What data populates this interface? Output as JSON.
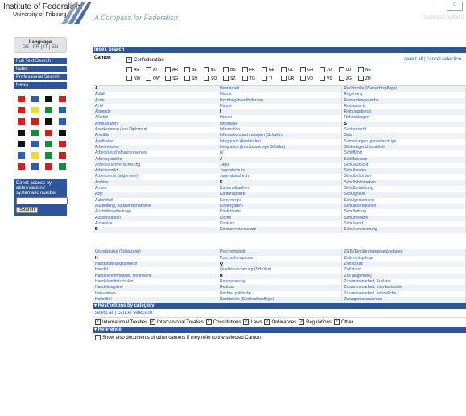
{
  "header": {
    "institute_line1": "Institute of Federalism",
    "institute_line2": "University of Fribourg",
    "tagline": "A Compass for Federalism",
    "supported": "Supported by the C"
  },
  "sidebar": {
    "language_title": "Language",
    "language_options": "DE | FR | IT | EN",
    "buttons": [
      "Full Text Search",
      "Index",
      "Professional Search",
      "News"
    ],
    "direct_title": "Direct access by abbreviation / systematic number",
    "search_label": "Search",
    "flag_colors": [
      [
        "#d02020",
        "#2a5fb0",
        "#111111",
        "#d02020"
      ],
      [
        "#d02020",
        "#e8e020",
        "#1a8a3a",
        "#2a5fb0"
      ],
      [
        "#d02020",
        "#d02020",
        "#111111",
        "#2a5fb0"
      ],
      [
        "#111111",
        "#1a8a3a",
        "#d02020",
        "#111111"
      ],
      [
        "#111111",
        "#2a5fb0",
        "#1a8a3a",
        "#d02020"
      ],
      [
        "#2a5fb0",
        "#e8e020",
        "#1a8a3a",
        "#d02020"
      ],
      [
        "#d02020",
        "#2a5fb0",
        "#d02020",
        "#1a8a3a"
      ]
    ]
  },
  "index": {
    "title": "Index Search",
    "canton_label": "Canton",
    "confederation": "Confederation",
    "select_all": "select all | cancel selection",
    "cantons_row1": [
      "AG",
      "AI",
      "AR",
      "BE",
      "BL",
      "BS",
      "FR",
      "GE",
      "GL",
      "GR",
      "JU",
      "LU",
      "NE"
    ],
    "cantons_row2": [
      "NW",
      "OW",
      "SG",
      "SH",
      "SO",
      "SZ",
      "TG",
      "TI",
      "UR",
      "VD",
      "VS",
      "ZG",
      "ZH"
    ],
    "rows": [
      [
        "A",
        "Heimarbeit",
        "Rechtshilfe (Zivilrechtspflege)"
      ],
      [
        "Abfall",
        "Heime",
        "Regierung"
      ],
      [
        "Ärzte",
        "Hochbegabtenförderung",
        "Reisendengewerbe"
      ],
      [
        "AHV",
        "Hunde",
        "Restaurants"
      ],
      [
        "Almende",
        "I",
        "Rettungsdienst"
      ],
      [
        "Alkohol",
        "Inkerei",
        "Rohrleitungen"
      ],
      [
        "Ambulanzen",
        "Informatik",
        "S"
      ],
      [
        "Anerkennung (von Diplomen)",
        "Information",
        "Sachenrecht"
      ],
      [
        "Anwälte",
        "Informationstechnologien (Schulen)",
        "Salz"
      ],
      [
        "Apotheker",
        "Integration (Ausländer)",
        "Sammlungen, gemeinnützige"
      ],
      [
        "Arbeitnehmer",
        "Integration (fremdsprachige Schüler)",
        "Schiedsgerichtsbarkeit"
      ],
      [
        "Arbeitsbeschaffungsreserven",
        "IV",
        "Schifffahrt"
      ],
      [
        "Arbeitsgerichte",
        "J",
        "Schiffsteuern"
      ],
      [
        "Arbeitslosenversicherung",
        "Jagd",
        "Schulaufsicht"
      ],
      [
        "Arbeitsmarkt",
        "Jugendschutz",
        "Schulbauten"
      ],
      [
        "Arbeitsrecht (allgemein)",
        "Jugendstrafrecht",
        "Schulbehörden"
      ],
      [
        "Archive",
        "K",
        "Schulbibliotheken"
      ],
      [
        "Armee",
        "Kantonalbanken",
        "Schulbetreibung"
      ],
      [
        "Asyl",
        "Kantonspolizei",
        "Schulgelder"
      ],
      [
        "Aufenthalt",
        "Kernenergie",
        "Schulgemeinden"
      ],
      [
        "Ausbildung, hauswirtschaftliche",
        "Kindergarten",
        "Schulkoordination"
      ],
      [
        "Ausbildungsbeiträge",
        "Kinderhorte",
        "Schulleitung"
      ],
      [
        "Aussenhandel",
        "Kirche",
        "Schulmedizin"
      ],
      [
        "Ausweise",
        "Konkurs",
        "Schulsport"
      ],
      [
        "B",
        "Konsumentenschutz",
        "Schulversicherung"
      ]
    ],
    "rows2": [
      [
        "Grundstücke (Schätzung)",
        "Psychomotorik",
        "ZGB (Einführungsgesetzgebung)"
      ],
      [
        "H",
        "Psychotherapeuten",
        "Zivilrechtspflege"
      ],
      [
        "Handänderungssteuern",
        "Q",
        "Zivilschutz"
      ],
      [
        "Handel",
        "Qualitätssicherung (Schulen)",
        "Zivilstand"
      ],
      [
        "Handelshemmnisse, technische",
        "R",
        "Zoll (allgemein)"
      ],
      [
        "Handelsmittelschulen",
        "Raumplanung",
        "Zusammenarbeit, Ausland"
      ],
      [
        "Handelsregister",
        "Rebbau",
        "Zusammenarbeit, interkantonale"
      ],
      [
        "Hebammen",
        "Rechte, politische",
        "Zusammenarbeit, polizeiliche"
      ],
      [
        "Heilmittel",
        "Rechtshilfe (Strafrechtspflege)",
        "Zwangsmassnahmen"
      ]
    ],
    "headers": [
      "A",
      "I",
      "S",
      "J",
      "K",
      "B",
      "H",
      "Q",
      "R"
    ]
  },
  "restrictions": {
    "title": "Restrictions by category",
    "select_all": "select all | cancel selection",
    "items": [
      "International Treaties",
      "Intercantonal Treaties",
      "Constitutions",
      "Laws",
      "Ordinances",
      "Regulations",
      "Other"
    ]
  },
  "reference": {
    "title": "Reference",
    "option": "Show also documents of other cantons if they refer to the selected Canton"
  }
}
